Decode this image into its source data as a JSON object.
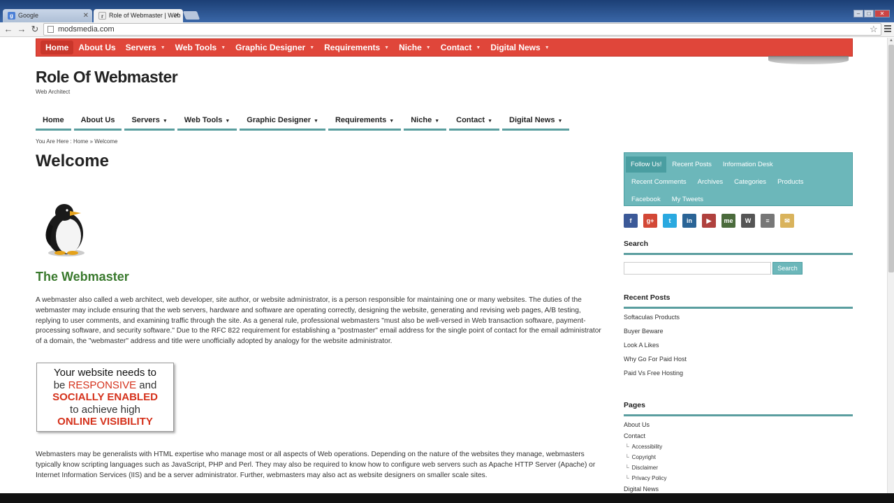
{
  "browser": {
    "tabs": [
      {
        "title": "Google",
        "favicon": "g-icon",
        "active": false
      },
      {
        "title": "Role of Webmaster | Web",
        "favicon": "page-icon",
        "active": true
      }
    ],
    "address": "modsmedia.com"
  },
  "topnav": {
    "items": [
      "Home",
      "About Us",
      "Servers",
      "Web Tools",
      "Graphic Designer",
      "Requirements",
      "Niche",
      "Contact",
      "Digital News"
    ],
    "has_dropdown": [
      false,
      false,
      true,
      true,
      true,
      true,
      true,
      true,
      true
    ],
    "color": "#e0463a"
  },
  "site": {
    "title": "Role Of Webmaster",
    "tagline": "Web Architect"
  },
  "secnav": {
    "items": [
      "Home",
      "About Us",
      "Servers",
      "Web Tools",
      "Graphic Designer",
      "Requirements",
      "Niche",
      "Contact",
      "Digital News"
    ],
    "has_dropdown": [
      false,
      false,
      true,
      true,
      true,
      true,
      true,
      true,
      true
    ],
    "accent": "#5a9e9f"
  },
  "breadcrumb": {
    "prefix": "You Are Here :",
    "home": "Home",
    "sep": "»",
    "current": "Welcome"
  },
  "main": {
    "title": "Welcome",
    "subheading": "The Webmaster",
    "para1": "A webmaster also called a web architect, web developer, site author, or website administrator, is a person responsible for maintaining one or many websites. The duties of the webmaster may include ensuring that the web servers, hardware and software are operating correctly, designing the website, generating and revising web pages, A/B testing, replying to user comments, and examining traffic through the site. As a general rule, professional webmasters \"must also be well-versed in Web transaction software, payment-processing software, and security software.\" Due to the RFC 822 requirement for establishing a \"postmaster\" email address for the single point of contact for the email administrator of a domain, the \"webmaster\" address and title were unofficially adopted by analogy for the website administrator.",
    "banner": {
      "line1": "Your website needs to",
      "line2a": "be ",
      "line2b": "RESPONSIVE",
      "line2c": " and",
      "line3": "SOCIALLY ENABLED",
      "line4": "to achieve high",
      "line5": "ONLINE VISIBILITY"
    },
    "para2": "Webmasters may be generalists with HTML expertise who manage most or all aspects of Web operations. Depending on the nature of the websites they manage, webmasters typically know scripting languages such as JavaScript, PHP and Perl. They may also be required to know how to configure web servers such as Apache HTTP Server (Apache) or Internet Information Services (IIS) and be a server administrator. Further, webmasters may also act as website designers on smaller scale sites."
  },
  "sidebar": {
    "tabs_row1": [
      "Follow Us!",
      "Recent Posts",
      "Information Desk"
    ],
    "tabs_row2": [
      "Recent Comments",
      "Archives",
      "Categories",
      "Products"
    ],
    "tabs_row3": [
      "Facebook",
      "My Tweets"
    ],
    "social_icons": [
      {
        "name": "facebook-icon",
        "glyph": "f",
        "color": "#3b5998"
      },
      {
        "name": "google-plus-icon",
        "glyph": "g+",
        "color": "#d34836"
      },
      {
        "name": "twitter-icon",
        "glyph": "t",
        "color": "#2aa9e0"
      },
      {
        "name": "linkedin-icon",
        "glyph": "in",
        "color": "#2a6496"
      },
      {
        "name": "youtube-icon",
        "glyph": "▶",
        "color": "#b0413e"
      },
      {
        "name": "aboutme-icon",
        "glyph": "me",
        "color": "#4b6b3c"
      },
      {
        "name": "wordpress-icon",
        "glyph": "W",
        "color": "#555"
      },
      {
        "name": "feed-icon",
        "glyph": "≡",
        "color": "#777"
      },
      {
        "name": "email-icon",
        "glyph": "✉",
        "color": "#d9b35c"
      }
    ],
    "search_heading": "Search",
    "search_button": "Search",
    "search_value": "",
    "recent_heading": "Recent Posts",
    "recent_posts": [
      "Softaculas Products",
      "Buyer Beware",
      "Look A Likes",
      "Why Go For Paid Host",
      "Paid Vs Free Hosting"
    ],
    "pages_heading": "Pages",
    "pages": [
      {
        "label": "About Us",
        "child": false
      },
      {
        "label": "Contact",
        "child": false
      },
      {
        "label": "Accessibility",
        "child": true
      },
      {
        "label": "Copyright",
        "child": true
      },
      {
        "label": "Disclaimer",
        "child": true
      },
      {
        "label": "Privacy Policy",
        "child": true
      },
      {
        "label": "Digital News",
        "child": false
      }
    ]
  }
}
